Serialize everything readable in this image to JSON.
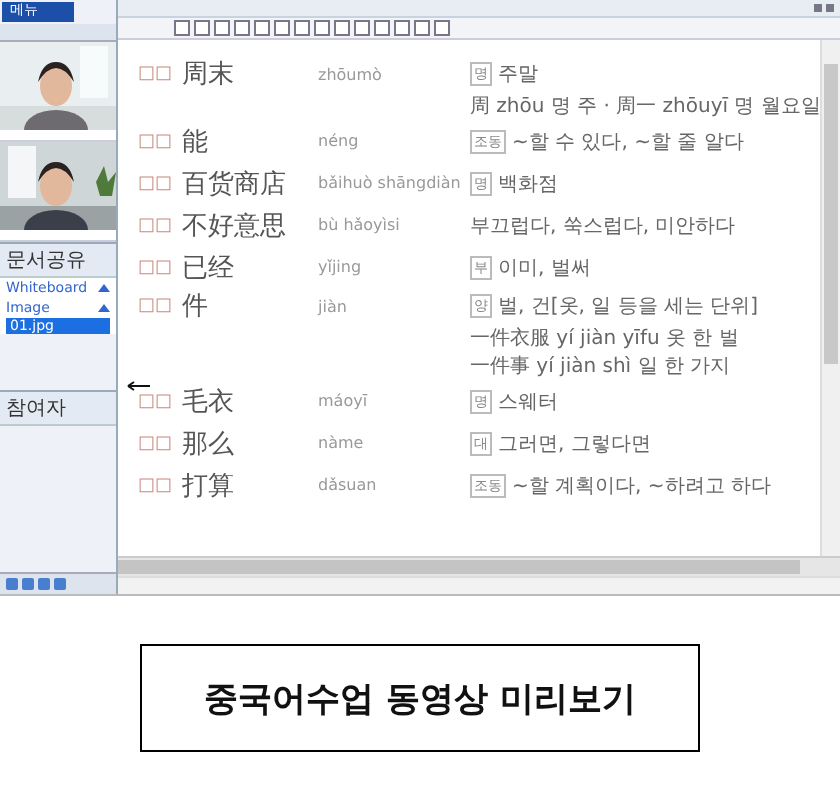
{
  "sidebar": {
    "menu_button": "메뉴",
    "documents": {
      "title": "문서공유",
      "groups": [
        {
          "label": "Whiteboard",
          "expanded": true
        },
        {
          "label": "Image",
          "expanded": true,
          "items": [
            {
              "label": "01.jpg",
              "selected": true
            }
          ]
        }
      ]
    },
    "participants": {
      "title": "참여자"
    }
  },
  "vocabulary": [
    {
      "mark": "□□",
      "hanzi": "周末",
      "pinyin": "zhōumò",
      "pos": "명",
      "meaning": "주말",
      "examples": [
        "周 zhōu 명 주 · 周一 zhōuyī 명 월요일"
      ]
    },
    {
      "mark": "□□",
      "hanzi": "能",
      "pinyin": "néng",
      "pos": "조동",
      "meaning": "~할 수 있다, ~할 줄 알다"
    },
    {
      "mark": "□□",
      "hanzi": "百货商店",
      "pinyin": "bǎihuò shāngdiàn",
      "pos": "명",
      "meaning": "백화점"
    },
    {
      "mark": "□□",
      "hanzi": "不好意思",
      "pinyin": "bù hǎoyìsi",
      "meaning": "부끄럽다, 쑥스럽다, 미안하다"
    },
    {
      "mark": "□□",
      "hanzi": "已经",
      "pinyin": "yǐjing",
      "pos": "부",
      "meaning": "이미, 벌써"
    },
    {
      "mark": "□□",
      "hanzi": "件",
      "pinyin": "jiàn",
      "pos": "양",
      "meaning": "벌, 건[옷, 일 등을 세는 단위]",
      "examples": [
        "一件衣服 yí jiàn yīfu 옷 한 벌",
        "一件事 yí jiàn shì 일 한 가지"
      ]
    },
    {
      "mark": "□□",
      "hanzi": "毛衣",
      "pinyin": "máoyī",
      "pos": "명",
      "meaning": "스웨터"
    },
    {
      "mark": "□□",
      "hanzi": "那么",
      "pinyin": "nàme",
      "pos": "대",
      "meaning": "그러면, 그렇다면"
    },
    {
      "mark": "□□",
      "hanzi": "打算",
      "pinyin": "dǎsuan",
      "pos": "조동",
      "meaning": "~할 계획이다, ~하려고 하다"
    }
  ],
  "caption": "중국어수업 동영상 미리보기"
}
